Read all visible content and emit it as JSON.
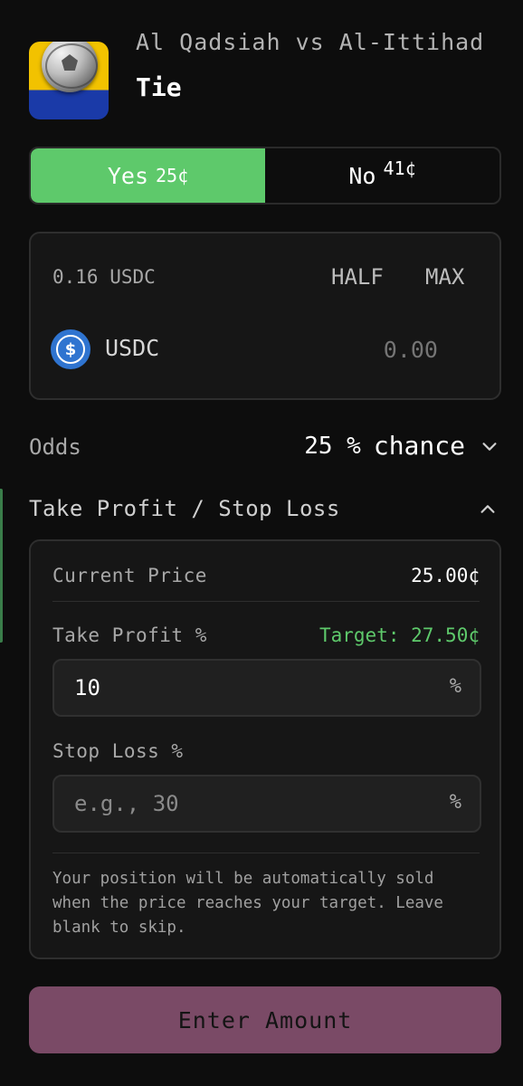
{
  "colors": {
    "background": "#0d0d0d",
    "yes_active": "#5ec96b",
    "target_green": "#5ec96b",
    "submit_bg": "#7a4a66",
    "usdc_blue": "#2f74d0"
  },
  "market": {
    "icon": "soccer-ball-icon",
    "title": "Al Qadsiah vs Al-Ittihad",
    "outcome": "Tie"
  },
  "toggle": {
    "yes_label": "Yes",
    "yes_price": "25¢",
    "no_label": "No",
    "no_price": "41¢",
    "selected": "Yes"
  },
  "amount": {
    "balance": "0.16 USDC",
    "half_label": "HALF",
    "max_label": "MAX",
    "token_icon": "usdc-icon",
    "token_label": "USDC",
    "placeholder": "0.00",
    "value": ""
  },
  "odds": {
    "label": "Odds",
    "percent": "25 %",
    "chance": "chance",
    "icon": "chevron-down-icon"
  },
  "tpsl": {
    "title": "Take Profit / Stop Loss",
    "icon": "chevron-up-icon",
    "current_price_label": "Current Price",
    "current_price_value": "25.00¢",
    "take_profit_label": "Take Profit %",
    "take_profit_target": "Target: 27.50¢",
    "take_profit_value": "10",
    "take_profit_suffix": "%",
    "stop_loss_label": "Stop Loss %",
    "stop_loss_placeholder": "e.g., 30",
    "stop_loss_value": "",
    "stop_loss_suffix": "%",
    "note": "Your position will be automatically sold when the price reaches your target. Leave blank to skip."
  },
  "submit": {
    "label": "Enter Amount"
  }
}
